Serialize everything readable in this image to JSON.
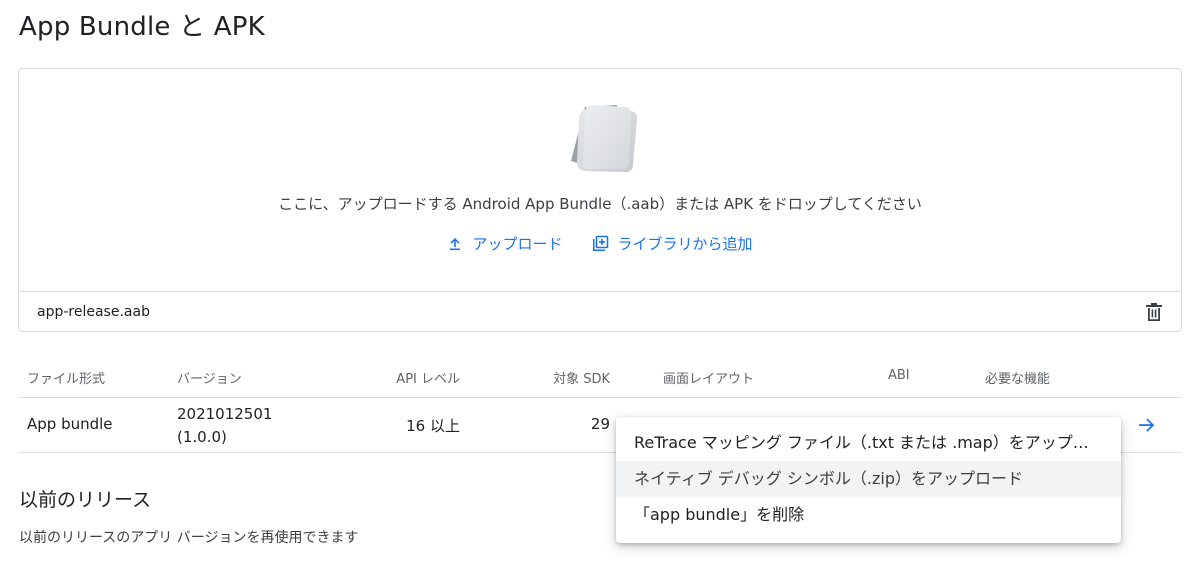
{
  "page": {
    "title": "App Bundle と APK"
  },
  "upload": {
    "hint": "ここに、アップロードする Android App Bundle（.aab）または APK をドロップしてください",
    "upload_label": "アップロード",
    "library_label": "ライブラリから追加",
    "file_name": "app-release.aab",
    "illustration_icon": "stacked-documents-icon",
    "upload_icon": "upload-icon",
    "library_icon": "library-add-icon",
    "delete_icon": "trash-icon"
  },
  "table": {
    "headers": [
      "ファイル形式",
      "バージョン",
      "API レベル",
      "対象 SDK",
      "画面レイアウト",
      "ABI",
      "必要な機能"
    ],
    "rows": [
      {
        "file_type": "App bundle",
        "version_code": "2021012501",
        "version_name": "(1.0.0)",
        "api_level": "16 以上",
        "target_sdk": "29",
        "row_icon": "arrow-right-icon"
      }
    ]
  },
  "context_menu": {
    "items": [
      "ReTrace マッピング ファイル（.txt または .map）をアップロード",
      "ネイティブ デバッグ シンボル（.zip）をアップロード",
      "「app bundle」を削除"
    ],
    "highlighted_index": 1
  },
  "previous": {
    "title": "以前のリリース",
    "description": "以前のリリースのアプリ バージョンを再使用できます"
  },
  "colors": {
    "accent": "#1a73e8",
    "border": "#dadce0",
    "text": "#202124",
    "muted": "#5f6368"
  }
}
